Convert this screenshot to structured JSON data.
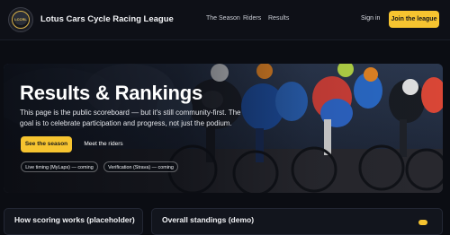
{
  "nav": {
    "logo_text": "LCCRL",
    "brand": "Lotus Cars Cycle Racing League",
    "links": [
      "The Season",
      "Riders",
      "Results"
    ],
    "signin": "Sign in",
    "join": "Join the league"
  },
  "hero": {
    "title": "Results & Rankings",
    "description": "This page is the public scoreboard — but it's still community-first. The goal is to celebrate participation and progress, not just the podium.",
    "primary_button": "See the season",
    "secondary_button": "Meet the riders",
    "chips": [
      "Live timing (MyLaps) — coming",
      "Verification (Strava) — coming"
    ]
  },
  "cards": {
    "scoring_title": "How scoring works (placeholder)",
    "standings_title": "Overall standings (demo)"
  },
  "colors": {
    "accent": "#f6c430",
    "background": "#0b0d13"
  }
}
